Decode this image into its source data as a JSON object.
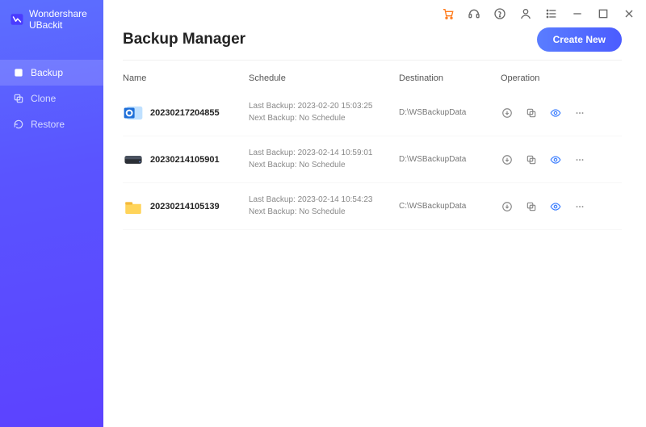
{
  "app": {
    "brand": "Wondershare UBackit"
  },
  "sidebar": {
    "items": [
      {
        "label": "Backup"
      },
      {
        "label": "Clone"
      },
      {
        "label": "Restore"
      }
    ]
  },
  "titlebar": {
    "icons": [
      "cart",
      "headset",
      "help",
      "account",
      "list",
      "minimize",
      "maximize",
      "close"
    ]
  },
  "header": {
    "title": "Backup Manager",
    "create_label": "Create New"
  },
  "columns": {
    "name": "Name",
    "schedule": "Schedule",
    "destination": "Destination",
    "operation": "Operation"
  },
  "schedule_labels": {
    "last_prefix": "Last Backup: ",
    "next_prefix": "Next Backup: "
  },
  "rows": [
    {
      "icon": "outlook",
      "name": "20230217204855",
      "last": "2023-02-20 15:03:25",
      "next": "No Schedule",
      "destination": "D:\\WSBackupData"
    },
    {
      "icon": "disk",
      "name": "20230214105901",
      "last": "2023-02-14 10:59:01",
      "next": "No Schedule",
      "destination": "D:\\WSBackupData"
    },
    {
      "icon": "folder",
      "name": "20230214105139",
      "last": "2023-02-14 10:54:23",
      "next": "No Schedule",
      "destination": "C:\\WSBackupData"
    }
  ]
}
